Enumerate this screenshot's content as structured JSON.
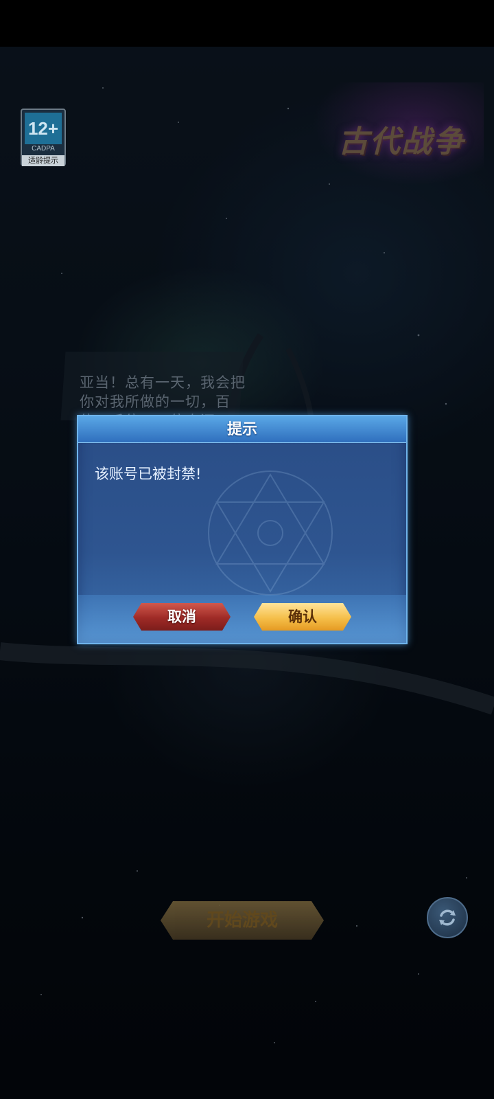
{
  "age_rating": {
    "number": "12+",
    "org": "CADPA",
    "tip": "适龄提示"
  },
  "game_logo": {
    "text": "古代战争"
  },
  "story_text": "亚当！总有一天，我会把你对我所做的一切，百倍，千倍，万倍奉还！！",
  "dialog": {
    "title": "提示",
    "message": "该账号已被封禁!",
    "cancel_label": "取消",
    "confirm_label": "确认"
  },
  "start_button": {
    "label": "开始游戏"
  },
  "refresh_button": {
    "icon": "refresh-icon"
  },
  "colors": {
    "dialog_bg": "#2e5590",
    "dialog_border": "#6fb4ec",
    "cancel_button": "#9e2a26",
    "confirm_button": "#f5bf4a"
  }
}
